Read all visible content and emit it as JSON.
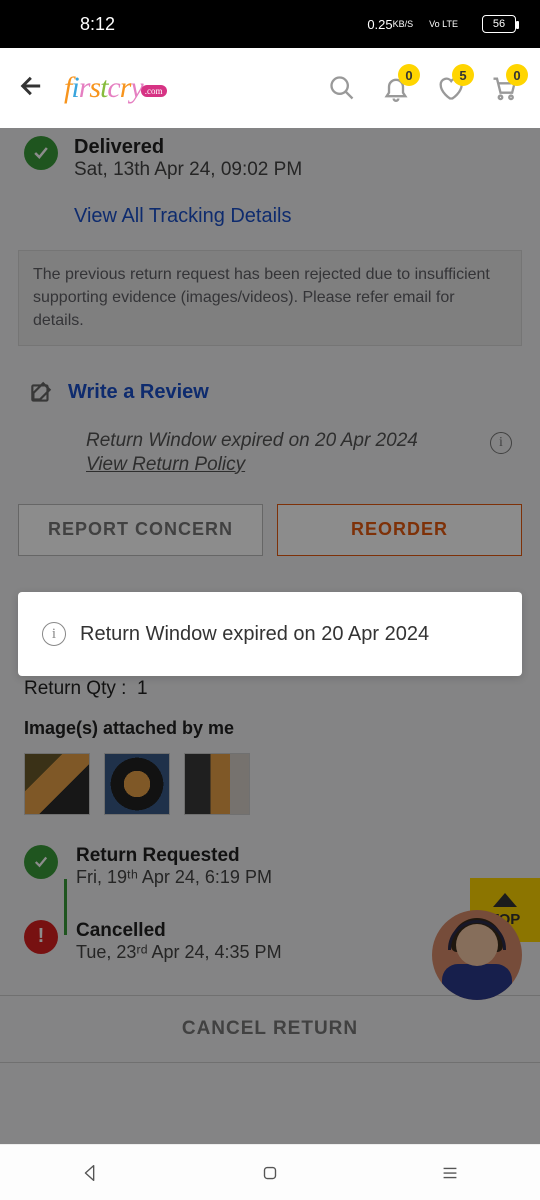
{
  "statusbar": {
    "time": "8:12",
    "net_speed": "0.25",
    "net_unit": "KB/S",
    "volte": "Vo LTE",
    "battery": "56"
  },
  "header": {
    "badge_notif": "0",
    "badge_wish": "5",
    "badge_cart": "0"
  },
  "delivered": {
    "title": "Delivered",
    "subtitle": "Sat, 13th Apr 24, 09:02 PM",
    "tracking_link": "View All Tracking Details"
  },
  "notice": "The previous return request has been rejected due to insufficient supporting evidence (images/videos). Please refer email for details.",
  "review_link": "Write a Review",
  "return_window": {
    "text": "Return Window expired on 20 Apr 2024",
    "policy": "View Return Policy"
  },
  "buttons": {
    "report": "REPORT CONCERN",
    "reorder": "REORDER"
  },
  "return_qty_label": "Return Qty :",
  "return_qty_value": "1",
  "images_label": "Image(s) attached by me",
  "timeline": {
    "requested_title": "Return Requested",
    "requested_date": "Fri, 19ᵗʰ Apr 24, 6:19 PM",
    "cancelled_title": "Cancelled",
    "cancelled_date": "Tue, 23ʳᵈ Apr 24, 4:35 PM"
  },
  "cancel_return": "CANCEL RETURN",
  "top_btn": "TOP",
  "toast": "Return Window expired on 20 Apr 2024"
}
